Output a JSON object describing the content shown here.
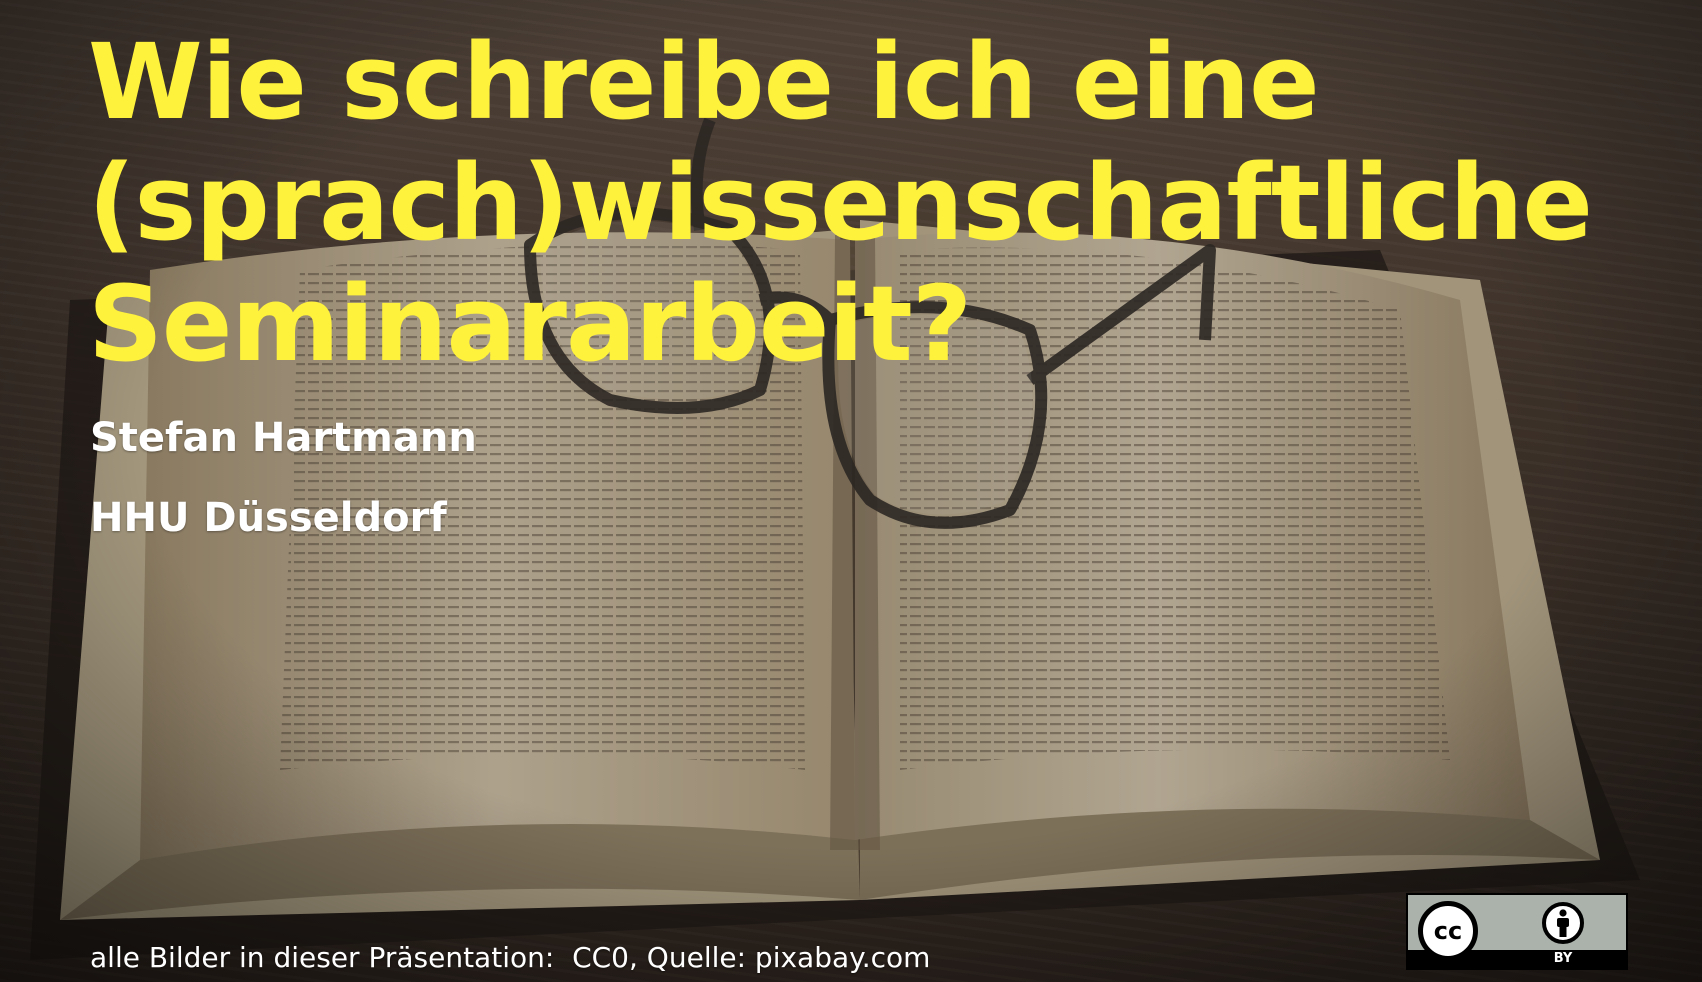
{
  "slide": {
    "title": "Wie schreibe ich eine\n(sprach)wissenschaftliche\nSeminararbeit?",
    "author": "Stefan Hartmann",
    "institution": "HHU Düsseldorf",
    "footer": "alle Bilder in dieser Präsentation:  CC0, Quelle: pixabay.com"
  },
  "license": {
    "cc_mark": "cc",
    "by_label": "BY",
    "icons": [
      "creative-commons-icon",
      "attribution-icon"
    ]
  },
  "background": {
    "description_icon": "open-book-with-glasses-photo"
  },
  "colors": {
    "title": "#fff23c",
    "text": "#ffffff",
    "badge_bg": "#aab2ab"
  }
}
